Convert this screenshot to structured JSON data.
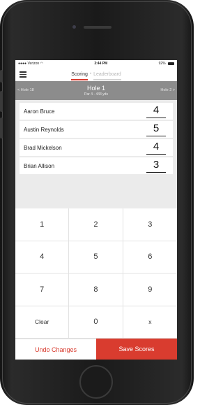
{
  "status": {
    "carrier": "Verizon",
    "time": "3:44 PM",
    "battery": "92%"
  },
  "nav": {
    "tab_scoring": "Scoring",
    "separator": "•",
    "tab_leaderboard": "Leaderboard"
  },
  "hole": {
    "title": "Hole 1",
    "subtitle": "Par 4 - 443 yds",
    "prev_label": "< Hole 18",
    "next_label": "Hole 2 >"
  },
  "players": [
    {
      "name": "Aaron Bruce",
      "score": "4"
    },
    {
      "name": "Austin Reynolds",
      "score": "5"
    },
    {
      "name": "Brad Mickelson",
      "score": "4"
    },
    {
      "name": "Brian Allison",
      "score": "3"
    }
  ],
  "keypad": [
    "1",
    "2",
    "3",
    "4",
    "5",
    "6",
    "7",
    "8",
    "9",
    "Clear",
    "0",
    "x"
  ],
  "actions": {
    "undo_label": "Undo Changes",
    "save_label": "Save Scores"
  },
  "colors": {
    "accent": "#d83b2e",
    "hole_bar": "#8c8c8c"
  }
}
